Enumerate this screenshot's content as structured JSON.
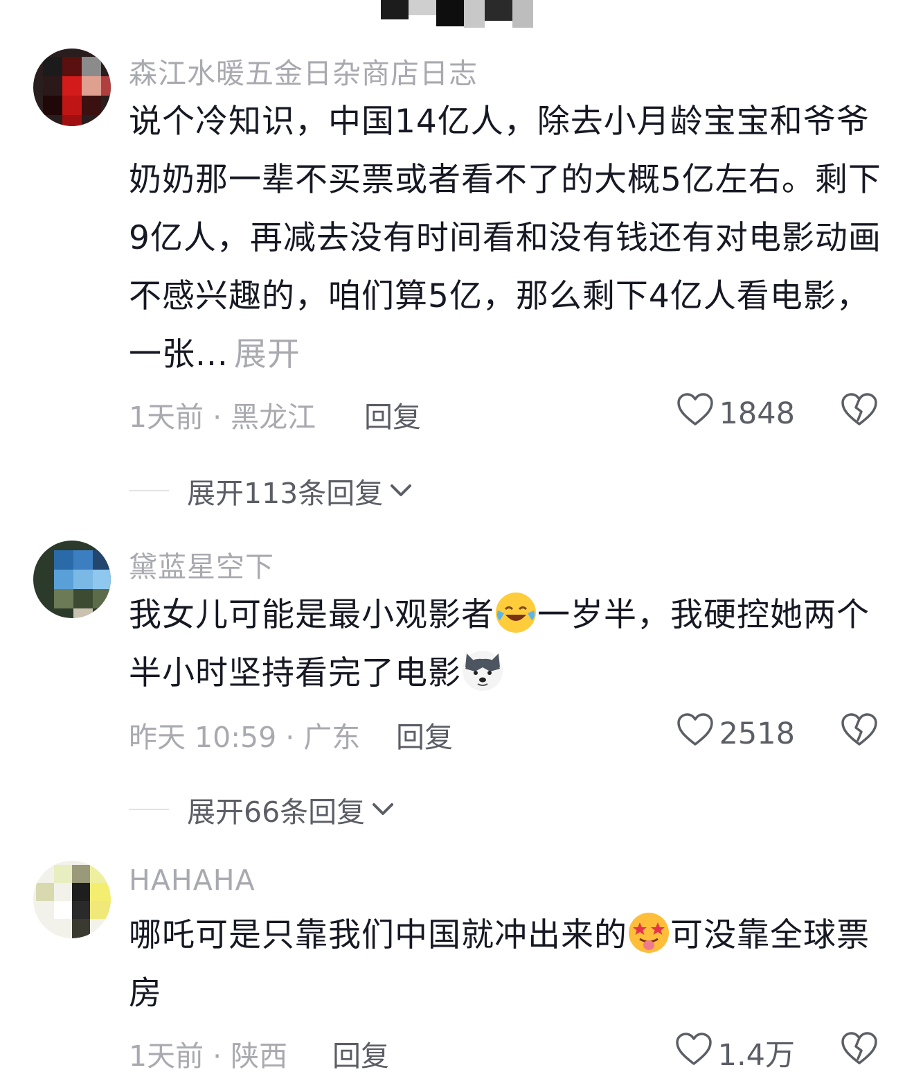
{
  "comments": [
    {
      "username": "森江水暖五金日杂商店日志",
      "content": "说个冷知识，中国14亿人，除去小月龄宝宝和爷爷奶奶那一辈不买票或者看不了的大概5亿左右。剩下9亿人，再减去没有时间看和没有钱还有对电影动画不感兴趣的，咱们算5亿，那么剩下4亿人看电影，一张...",
      "more_label": "展开",
      "time_location": "1天前 · 黑龙江",
      "reply_label": "回复",
      "likes": "1848",
      "expand_label": "展开113条回复"
    },
    {
      "username": "黛蓝星空下",
      "content_part1": "我女儿可能是最小观影者",
      "content_part2": "一岁半，我硬控她两个半小时坚持看完了电影",
      "emoji1": "face-with-tears-of-joy",
      "emoji2": "husky-dog-face",
      "time_location": "昨天 10:59 · 广东",
      "reply_label": "回复",
      "likes": "2518",
      "expand_label": "展开66条回复"
    },
    {
      "username": "HAHAHA",
      "content_part1": "哪吒可是只靠我们中国就冲出来的",
      "content_part2": "可没靠全球票房",
      "emoji1": "star-struck-tongue-face",
      "time_location": "1天前 · 陕西",
      "reply_label": "回复",
      "likes": "1.4万"
    }
  ],
  "colors": {
    "text": "#161823",
    "secondary": "#a9aab0",
    "action": "#5c5e66"
  }
}
